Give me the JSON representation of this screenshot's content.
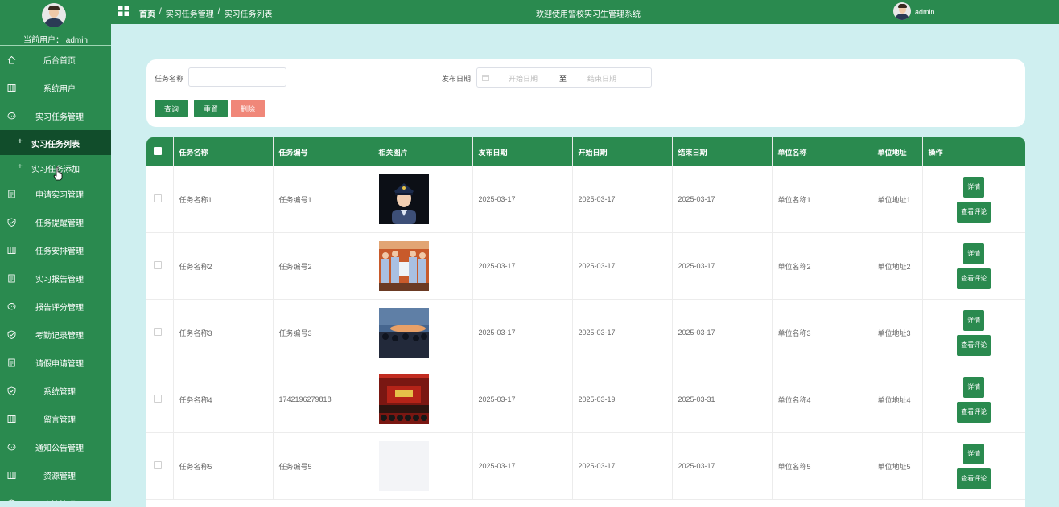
{
  "sidebar": {
    "current_user": "当前用户： admin",
    "menu": [
      {
        "label": "后台首页",
        "icon": "home-icon"
      },
      {
        "label": "系统用户",
        "icon": "columns-icon"
      },
      {
        "label": "实习任务管理",
        "icon": "chat-icon"
      }
    ],
    "submenu": [
      {
        "label": "实习任务列表",
        "active": true
      },
      {
        "label": "实习任务添加",
        "active": false
      }
    ],
    "menu2": [
      {
        "label": "申请实习管理",
        "icon": "document-icon"
      },
      {
        "label": "任务提醒管理",
        "icon": "shield-icon"
      },
      {
        "label": "任务安排管理",
        "icon": "columns-icon"
      },
      {
        "label": "实习报告管理",
        "icon": "document-icon"
      },
      {
        "label": "报告评分管理",
        "icon": "chat-icon"
      },
      {
        "label": "考勤记录管理",
        "icon": "shield-icon"
      },
      {
        "label": "请假申请管理",
        "icon": "document-icon"
      },
      {
        "label": "系统管理",
        "icon": "shield-icon"
      },
      {
        "label": "留言管理",
        "icon": "columns-icon"
      },
      {
        "label": "通知公告管理",
        "icon": "chat-icon"
      },
      {
        "label": "资源管理",
        "icon": "columns-icon"
      },
      {
        "label": "交流管理",
        "icon": "shield-icon"
      }
    ]
  },
  "topbar": {
    "breadcrumb": [
      "首页",
      "/",
      "实习任务管理",
      "/",
      "实习任务列表"
    ],
    "welcome": "欢迎使用警校实习生管理系统",
    "user": "admin"
  },
  "search": {
    "name_label": "任务名称",
    "name_value": "",
    "date_label": "发布日期",
    "start_placeholder": "开始日期",
    "separator": "至",
    "end_placeholder": "结束日期",
    "query_btn": "查询",
    "reset_btn": "重置",
    "delete_btn": "删除"
  },
  "table": {
    "headers": [
      "任务名称",
      "任务编号",
      "相关图片",
      "发布日期",
      "开始日期",
      "结束日期",
      "单位名称",
      "单位地址",
      "操作"
    ],
    "rows": [
      {
        "name": "任务名称1",
        "code": "任务编号1",
        "image": "officer-portrait",
        "publish": "2025-03-17",
        "start": "2025-03-17",
        "end": "2025-03-17",
        "unit": "单位名称1",
        "addr": "单位地址1"
      },
      {
        "name": "任务名称2",
        "code": "任务编号2",
        "image": "group-photo",
        "publish": "2025-03-17",
        "start": "2025-03-17",
        "end": "2025-03-17",
        "unit": "单位名称2",
        "addr": "单位地址2"
      },
      {
        "name": "任务名称3",
        "code": "任务编号3",
        "image": "sunset-crowd",
        "publish": "2025-03-17",
        "start": "2025-03-17",
        "end": "2025-03-17",
        "unit": "单位名称3",
        "addr": "单位地址3"
      },
      {
        "name": "任务名称4",
        "code": "1742196279818",
        "image": "stage-event",
        "publish": "2025-03-17",
        "start": "2025-03-19",
        "end": "2025-03-31",
        "unit": "单位名称4",
        "addr": "单位地址4"
      },
      {
        "name": "任务名称5",
        "code": "任务编号5",
        "image": "blank",
        "publish": "2025-03-17",
        "start": "2025-03-17",
        "end": "2025-03-17",
        "unit": "单位名称5",
        "addr": "单位地址5"
      }
    ],
    "detail_btn": "详情",
    "comment_btn": "查看评论"
  },
  "colors": {
    "primary": "#2a8a4f",
    "sidebar_active": "#114d2b",
    "danger": "#f08779",
    "page_bg": "#cfeff0"
  }
}
